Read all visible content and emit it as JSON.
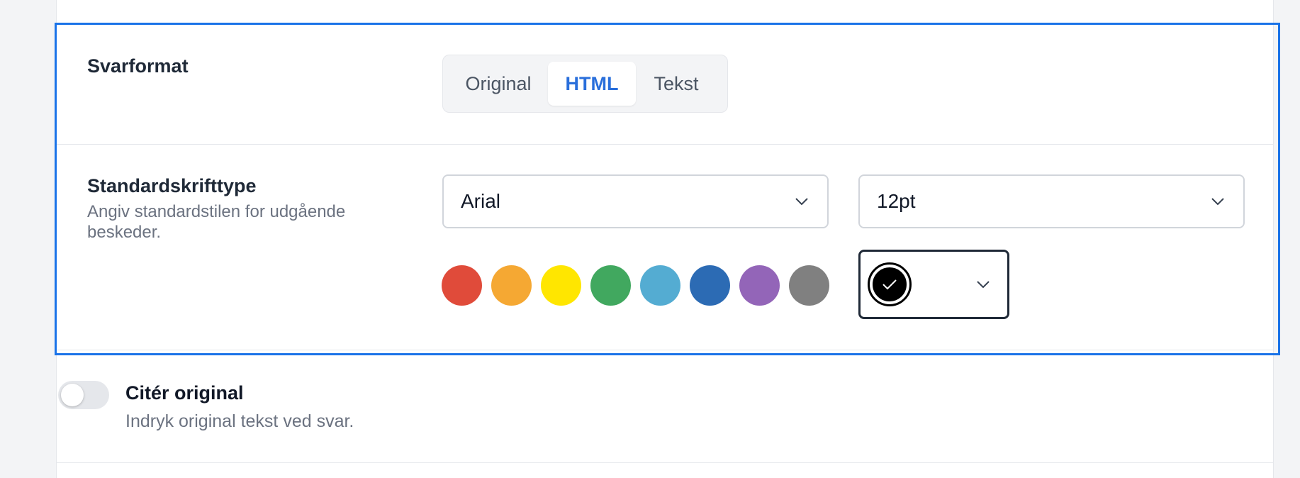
{
  "reply_format": {
    "title": "Svarformat",
    "options": [
      "Original",
      "HTML",
      "Tekst"
    ],
    "selected": "HTML"
  },
  "default_font": {
    "title": "Standardskrifttype",
    "description_line1": "Angiv standardstilen for udgående",
    "description_line2": "beskeder.",
    "font_family_value": "Arial",
    "font_size_value": "12pt",
    "swatches": [
      "#e04b3a",
      "#f5a833",
      "#ffe600",
      "#41a85f",
      "#54acd2",
      "#2c6bb4",
      "#9365b8",
      "#808080"
    ],
    "selected_color": "#000000"
  },
  "quote_original": {
    "title": "Citér original",
    "description": "Indryk original tekst ved svar.",
    "enabled": false
  },
  "colors": {
    "focus": "#1a73e8",
    "accent": "#2a6fdb"
  }
}
